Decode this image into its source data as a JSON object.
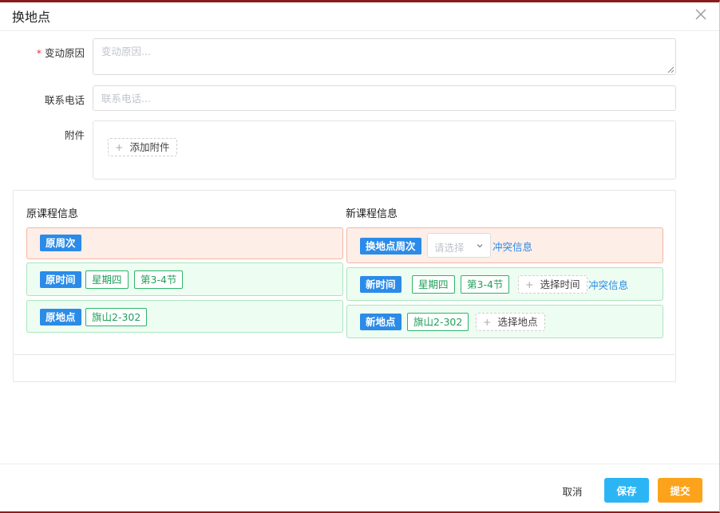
{
  "dialog": {
    "title": "换地点"
  },
  "form": {
    "reason": {
      "required_mark": "*",
      "label": "变动原因",
      "placeholder": "变动原因...",
      "value": ""
    },
    "phone": {
      "label": "联系电话",
      "placeholder": "联系电话...",
      "value": ""
    },
    "attachment": {
      "label": "附件",
      "add_icon": "plus-icon",
      "add_label": "添加附件"
    }
  },
  "original_course": {
    "title": "原课程信息",
    "week": {
      "tag": "原周次"
    },
    "time": {
      "tag": "原时间",
      "weekday": "星期四",
      "period": "第3-4节"
    },
    "location": {
      "tag": "原地点",
      "room": "旗山2-302"
    }
  },
  "new_course": {
    "title": "新课程信息",
    "week": {
      "tag": "换地点周次",
      "select_placeholder": "请选择",
      "conflict_link": "冲突信息"
    },
    "time": {
      "tag": "新时间",
      "weekday": "星期四",
      "period": "第3-4节",
      "select_label": "选择时间",
      "conflict_link": "冲突信息"
    },
    "location": {
      "tag": "新地点",
      "room": "旗山2-302",
      "select_label": "选择地点"
    }
  },
  "footer": {
    "cancel": "取消",
    "save": "保存",
    "submit": "提交"
  },
  "colors": {
    "primary_blue": "#2b8be8",
    "save_button": "#2cb5f5",
    "submit_button": "#fca31b",
    "tag_green": "#21a05a",
    "red_bar_bg": "#fdeee8",
    "green_bar_bg": "#eefdf2",
    "required": "#e33333"
  }
}
